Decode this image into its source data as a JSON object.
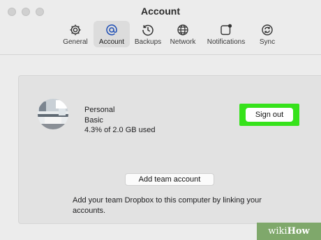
{
  "window": {
    "title": "Account"
  },
  "toolbar": {
    "items": [
      {
        "label": "General",
        "icon": "gear-icon",
        "active": false
      },
      {
        "label": "Account",
        "icon": "at-sign-icon",
        "active": true
      },
      {
        "label": "Backups",
        "icon": "clock-history-icon",
        "active": false
      },
      {
        "label": "Network",
        "icon": "globe-icon",
        "active": false
      },
      {
        "label": "Notifications",
        "icon": "notification-badge-icon",
        "active": false
      },
      {
        "label": "Sync",
        "icon": "sync-icon",
        "active": false
      }
    ]
  },
  "account": {
    "name": "Personal",
    "plan": "Basic",
    "usage": "4.3% of 2.0 GB used",
    "sign_out_label": "Sign out"
  },
  "team": {
    "add_label": "Add team account",
    "description": "Add your team Dropbox to this computer by linking your accounts."
  },
  "watermark": {
    "part1": "wiki",
    "part2": "How"
  },
  "colors": {
    "highlight": "#36e21b",
    "watermark": "#7fa86b"
  }
}
